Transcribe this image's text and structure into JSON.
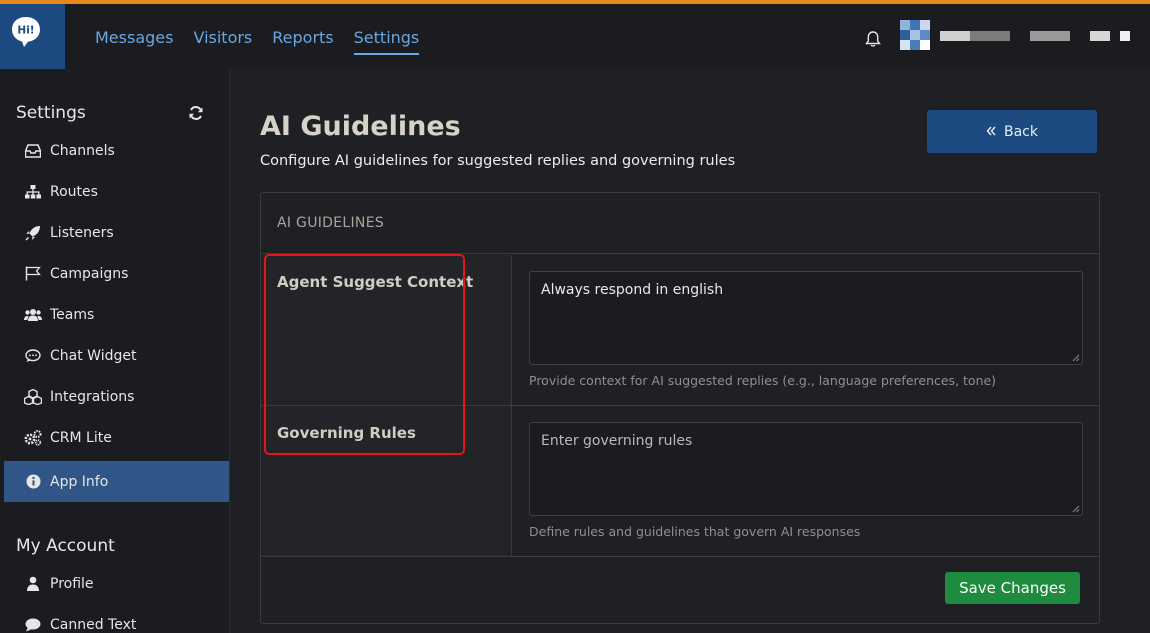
{
  "app": {
    "logo_text": "Hi!"
  },
  "nav": {
    "items": [
      "Messages",
      "Visitors",
      "Reports",
      "Settings"
    ],
    "active": "Settings"
  },
  "colors": {
    "accent": "#1d4a80",
    "link": "#6aa6e0",
    "success": "#1f8b3e",
    "highlight": "#e0161b",
    "top_strip": "#e8891c"
  },
  "sidebar": {
    "settings_heading": "Settings",
    "items": [
      {
        "label": "Channels",
        "icon": "inbox-icon"
      },
      {
        "label": "Routes",
        "icon": "sitemap-icon"
      },
      {
        "label": "Listeners",
        "icon": "rocket-icon"
      },
      {
        "label": "Campaigns",
        "icon": "flag-icon"
      },
      {
        "label": "Teams",
        "icon": "users-icon"
      },
      {
        "label": "Chat Widget",
        "icon": "comment-icon"
      },
      {
        "label": "Integrations",
        "icon": "cubes-icon"
      },
      {
        "label": "CRM Lite",
        "icon": "cogs-icon"
      },
      {
        "label": "App Info",
        "icon": "info-circle-icon",
        "active": true
      }
    ],
    "account_heading": "My Account",
    "account_items": [
      {
        "label": "Profile",
        "icon": "user-icon"
      },
      {
        "label": "Canned Text",
        "icon": "chat-bubble-icon"
      }
    ]
  },
  "main": {
    "title": "AI Guidelines",
    "subtitle": "Configure AI guidelines for suggested replies and governing rules",
    "back_label": "Back",
    "panel_heading": "AI GUIDELINES",
    "fields": [
      {
        "label": "Agent Suggest Context",
        "value": "Always respond in english",
        "placeholder": "",
        "help": "Provide context for AI suggested replies (e.g., language preferences, tone)"
      },
      {
        "label": "Governing Rules",
        "value": "",
        "placeholder": "Enter governing rules",
        "help": "Define rules and guidelines that govern AI responses"
      }
    ],
    "save_label": "Save Changes"
  }
}
